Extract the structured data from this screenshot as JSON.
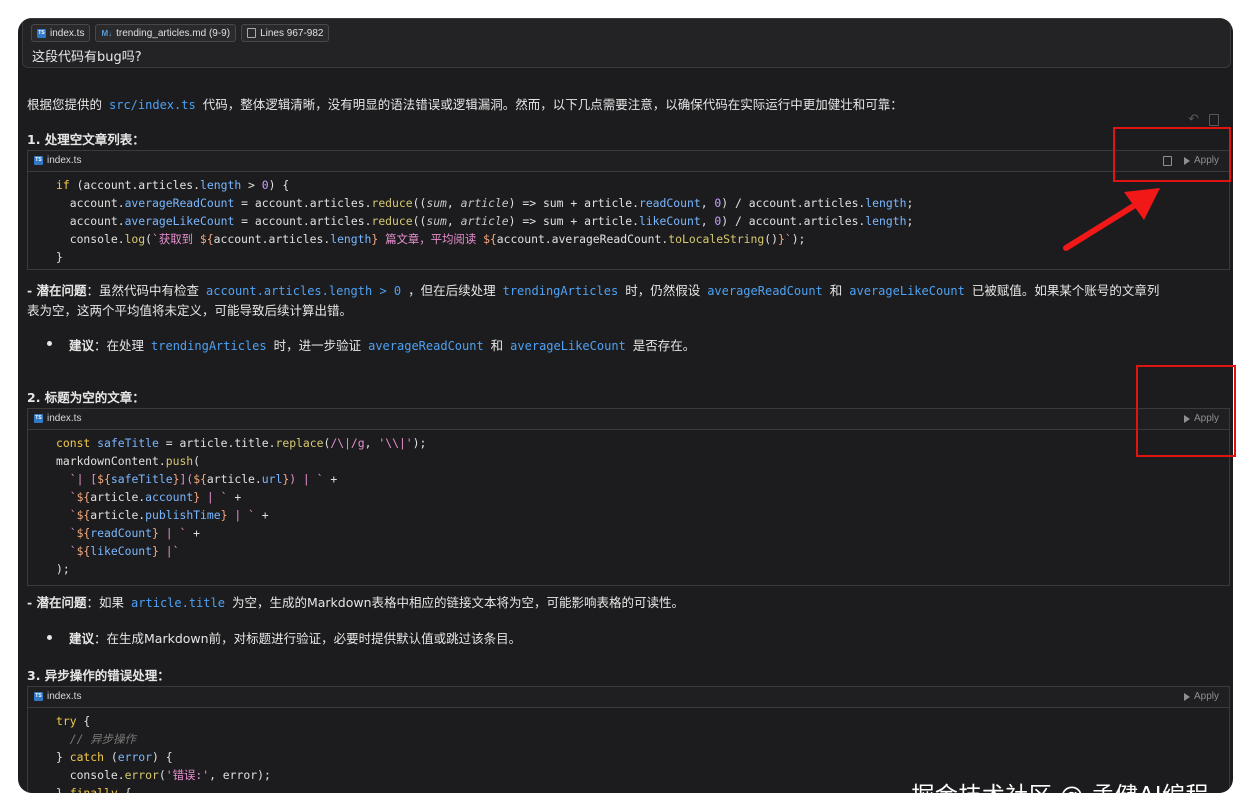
{
  "context_chips": [
    {
      "label": "index.ts",
      "icon": "typescript-icon"
    },
    {
      "label": "trending_articles.md (9-9)",
      "icon": "markdown-icon"
    },
    {
      "label": "Lines 967-982",
      "icon": "lines-icon"
    }
  ],
  "question": "这段代码有bug吗?",
  "intro": {
    "before": "根据您提供的",
    "code": "src/index.ts",
    "after": "代码，整体逻辑清晰，没有明显的语法错误或逻辑漏洞。然而，以下几点需要注意，以确保代码在实际运行中更加健壮和可靠："
  },
  "sections": [
    {
      "heading": "1. 处理空文章列表："
    },
    {
      "heading": "2. 标题为空的文章："
    },
    {
      "heading": "3. 异步操作的错误处理："
    }
  ],
  "code_blocks": [
    {
      "filename": "index.ts",
      "apply": "Apply"
    },
    {
      "filename": "index.ts",
      "apply": "Apply"
    },
    {
      "filename": "index.ts",
      "apply": "Apply"
    }
  ],
  "issue1": {
    "label": "- 潜在问题",
    "t1": "：虽然代码中有检查",
    "c1": "account.articles.length > 0",
    "t2": "，但在后续处理",
    "c2": "trendingArticles",
    "t3": "时，仍然假设",
    "c3": "averageReadCount",
    "t4": "和",
    "c4": "averageLikeCount",
    "t5": "已被赋值。如果某个账号的文章列",
    "line2": "表为空，这两个平均值将未定义，可能导致后续计算出错。"
  },
  "suggest1": {
    "label": "建议",
    "t1": "：在处理",
    "c1": "trendingArticles",
    "t2": "时，进一步验证",
    "c2": "averageReadCount",
    "t3": "和",
    "c3": "averageLikeCount",
    "t4": "是否存在。"
  },
  "issue2": {
    "label": "- 潜在问题",
    "t1": "：如果",
    "c1": "article.title",
    "t2": "为空，生成的Markdown表格中相应的链接文本将为空，可能影响表格的可读性。"
  },
  "suggest2": {
    "label": "建议",
    "t1": "：在生成Markdown前，对标题进行验证，必要时提供默认值或跳过该条目。"
  },
  "watermark": "掘金技术社区 @ 孟健AI编程"
}
